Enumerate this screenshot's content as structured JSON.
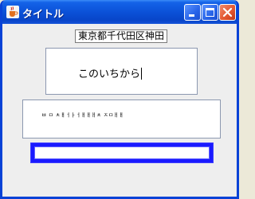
{
  "window": {
    "title": "タイトル",
    "icon": "java-cup-icon",
    "controls": [
      "minimize",
      "maximize",
      "close"
    ]
  },
  "top_label": {
    "text": "東京都千代田区神田"
  },
  "text_area": {
    "text": "このいちから"
  },
  "small_text": {
    "text": "ㅂ ㅁ ㅊㅐㅓㅏㅓㅐㅐㅐㅊ ㅈㅁㅐㅐ"
  },
  "input_field": {
    "value": ""
  },
  "colors": {
    "titlebar": "#0a4fd6",
    "window_border": "#0842d6",
    "content_bg": "#eeeeee",
    "focus_border": "#1a1aff"
  }
}
